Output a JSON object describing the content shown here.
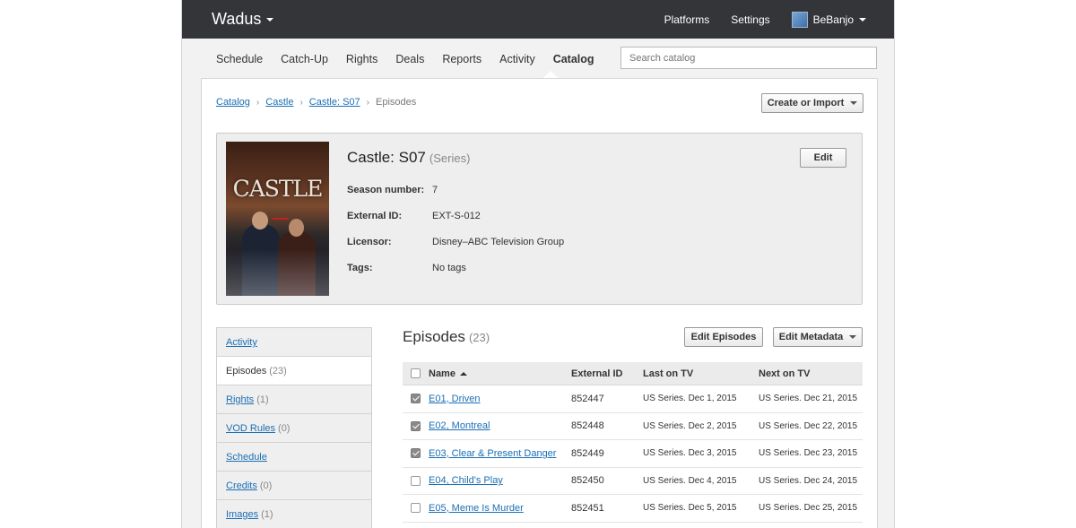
{
  "app": {
    "brand": "Wadus"
  },
  "topnav": {
    "platforms": "Platforms",
    "settings": "Settings",
    "user": "BeBanjo"
  },
  "tabs": [
    "Schedule",
    "Catch-Up",
    "Rights",
    "Deals",
    "Reports",
    "Activity",
    "Catalog"
  ],
  "active_tab": "Catalog",
  "search": {
    "placeholder": "Search catalog",
    "value": ""
  },
  "breadcrumb": {
    "items": [
      "Catalog",
      "Castle",
      "Castle: S07"
    ],
    "current": "Episodes"
  },
  "create_button": "Create or Import",
  "series": {
    "title": "Castle: S07",
    "type": "(Series)",
    "edit": "Edit",
    "poster_title": "CASTLE",
    "fields": [
      {
        "label": "Season number:",
        "value": "7"
      },
      {
        "label": "External ID:",
        "value": "EXT-S-012"
      },
      {
        "label": "Licensor:",
        "value": "Disney–ABC Television Group"
      },
      {
        "label": "Tags:",
        "value": "No tags"
      }
    ]
  },
  "sidebar": [
    {
      "label": "Activity",
      "count": ""
    },
    {
      "label": "Episodes",
      "count": "(23)"
    },
    {
      "label": "Rights",
      "count": "(1)"
    },
    {
      "label": "VOD Rules",
      "count": "(0)"
    },
    {
      "label": "Schedule",
      "count": ""
    },
    {
      "label": "Credits",
      "count": "(0)"
    },
    {
      "label": "Images",
      "count": "(1)"
    }
  ],
  "episodes": {
    "title": "Episodes",
    "count": "(23)",
    "edit_episodes": "Edit Episodes",
    "edit_metadata": "Edit Metadata",
    "columns": [
      "Name",
      "External ID",
      "Last on TV",
      "Next on TV"
    ],
    "rows": [
      {
        "checked": true,
        "name": "E01, Driven",
        "ext": "852447",
        "last": "US Series. Dec 1, 2015",
        "next": "US Series. Dec 21, 2015"
      },
      {
        "checked": true,
        "name": "E02, Montreal",
        "ext": "852448",
        "last": "US Series. Dec 2, 2015",
        "next": "US Series. Dec 22, 2015"
      },
      {
        "checked": true,
        "name": "E03, Clear & Present Danger",
        "ext": "852449",
        "last": "US Series. Dec 3, 2015",
        "next": "US Series. Dec 23, 2015"
      },
      {
        "checked": false,
        "name": "E04, Child's Play",
        "ext": "852450",
        "last": "US Series. Dec 4, 2015",
        "next": "US Series. Dec 24, 2015"
      },
      {
        "checked": false,
        "name": "E05, Meme Is Murder",
        "ext": "852451",
        "last": "US Series. Dec 5, 2015",
        "next": "US Series. Dec 25, 2015"
      }
    ]
  }
}
